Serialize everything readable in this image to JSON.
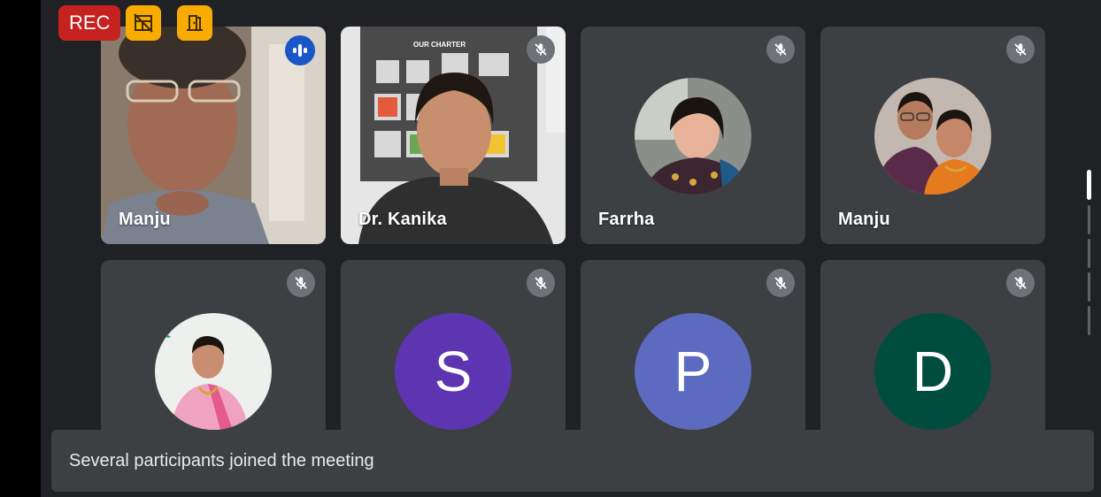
{
  "recording": {
    "label": "REC"
  },
  "status_icons": [
    "no-video-layout-icon",
    "door-exit-icon"
  ],
  "participants": [
    {
      "name": "Manju",
      "kind": "video",
      "speaking": true
    },
    {
      "name": "Dr. Kanika",
      "kind": "video",
      "muted": true,
      "background_text": "OUR CHARTER"
    },
    {
      "name": "Farrha",
      "kind": "photo",
      "muted": true
    },
    {
      "name": "Manju",
      "kind": "photo",
      "muted": true
    },
    {
      "name": "",
      "kind": "photo",
      "muted": true
    },
    {
      "name": "",
      "kind": "letter",
      "letter": "S",
      "color": "#5e35b1",
      "muted": true
    },
    {
      "name": "",
      "kind": "letter",
      "letter": "P",
      "color": "#5c6bc0",
      "muted": true
    },
    {
      "name": "",
      "kind": "letter",
      "letter": "D",
      "color": "#004d40",
      "muted": true
    }
  ],
  "toast": {
    "message": "Several participants joined the meeting"
  },
  "colors": {
    "speaking_outline": "#1a56c8",
    "tile_bg": "#3c4043",
    "rec_red": "#c5221f",
    "badge_yellow": "#f9ab00"
  }
}
